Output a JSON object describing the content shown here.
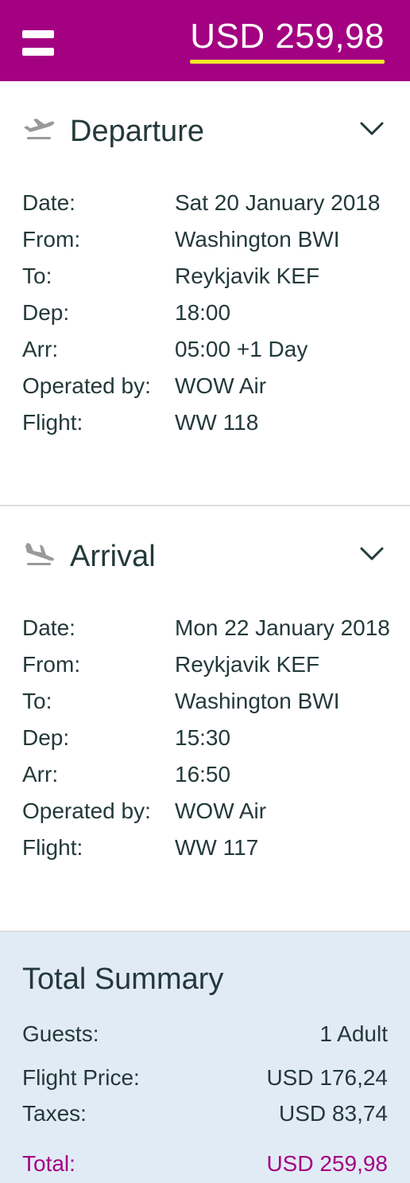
{
  "header": {
    "price": "USD 259,98",
    "colors": {
      "brand": "#a30082",
      "accent": "#f5e52a"
    },
    "menu_icon": "hamburger-menu-icon"
  },
  "departure": {
    "title": "Departure",
    "icon": "plane-takeoff-icon",
    "rows": [
      {
        "label": "Date:",
        "value": "Sat 20 January 2018"
      },
      {
        "label": "From:",
        "value": "Washington BWI"
      },
      {
        "label": "To:",
        "value": "Reykjavik KEF"
      },
      {
        "label": "Dep:",
        "value": "18:00"
      },
      {
        "label": "Arr:",
        "value": "05:00 +1 Day"
      },
      {
        "label": "Operated by:",
        "value": "WOW Air"
      },
      {
        "label": "Flight:",
        "value": "WW 118"
      }
    ]
  },
  "arrival": {
    "title": "Arrival",
    "icon": "plane-landing-icon",
    "rows": [
      {
        "label": "Date:",
        "value": "Mon 22 January 2018"
      },
      {
        "label": "From:",
        "value": "Reykjavik KEF"
      },
      {
        "label": "To:",
        "value": "Washington BWI"
      },
      {
        "label": "Dep:",
        "value": "15:30"
      },
      {
        "label": "Arr:",
        "value": "16:50"
      },
      {
        "label": "Operated by:",
        "value": "WOW Air"
      },
      {
        "label": "Flight:",
        "value": "WW 117"
      }
    ]
  },
  "summary": {
    "title": "Total Summary",
    "guests_label": "Guests:",
    "guests_value": "1 Adult",
    "flight_price_label": "Flight Price:",
    "flight_price_value": "USD 176,24",
    "taxes_label": "Taxes:",
    "taxes_value": "USD 83,74",
    "total_label": "Total:",
    "total_value": "USD 259,98"
  }
}
